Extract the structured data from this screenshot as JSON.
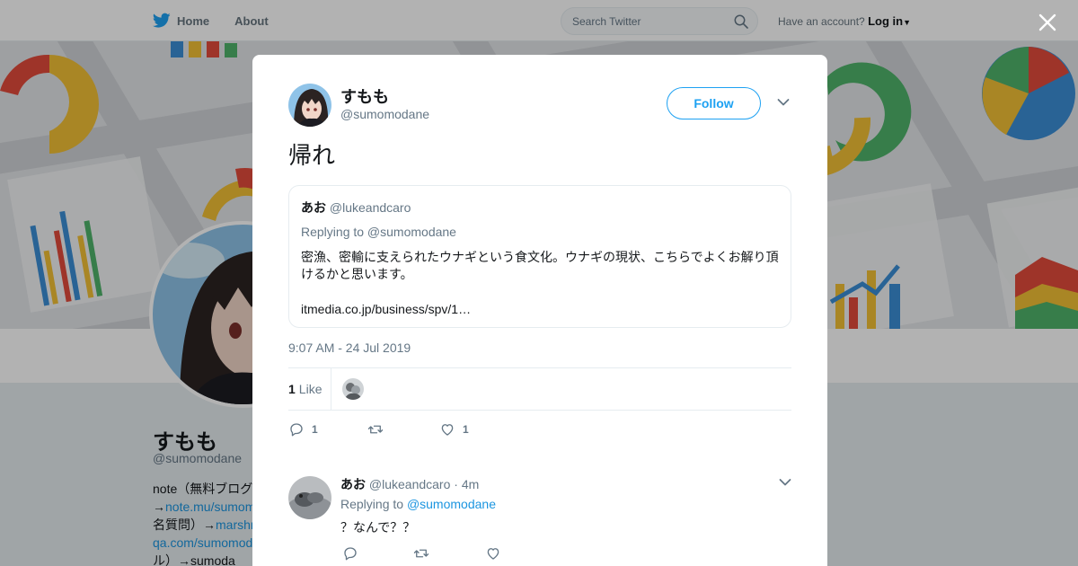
{
  "nav": {
    "home": "Home",
    "about": "About",
    "search_placeholder": "Search Twitter",
    "have_account": "Have an account?",
    "login": "Log in"
  },
  "profile": {
    "name": "すもも",
    "handle": "@sumomodane",
    "bio_lines": [
      {
        "pre": "note（無料ブログ",
        "link": ""
      },
      {
        "pre": "→",
        "link": "note.mu/sumom"
      },
      {
        "pre": "名質問）→",
        "link": "marshm"
      },
      {
        "pre": "",
        "link": "qa.com/sumomod"
      },
      {
        "pre": "ル）→sumoda",
        "link": ""
      }
    ]
  },
  "tweet": {
    "name": "すもも",
    "handle": "@sumomodane",
    "follow_label": "Follow",
    "text": "帰れ",
    "timestamp": "9:07 AM - 24 Jul 2019",
    "likes_count": "1",
    "likes_label": "Like",
    "actions": {
      "reply_count": "1",
      "retweet_count": "",
      "like_count": "1"
    },
    "quoted": {
      "name": "あお",
      "handle": "@lukeandcaro",
      "replying_to": "Replying to @sumomodane",
      "body": "密漁、密輸に支えられたウナギという食文化。ウナギの現状、こちらでよくお解り頂けるかと思います。",
      "link": "itmedia.co.jp/business/spv/1…"
    }
  },
  "reply": {
    "name": "あお",
    "handle": "@lukeandcaro",
    "time": "· 4m",
    "replying_prefix": "Replying to",
    "replying_handle": "@sumomodane",
    "text": "？なんで？？"
  },
  "colors": {
    "accent": "#1da1f2",
    "link": "#1b95e0",
    "muted": "#657786"
  }
}
